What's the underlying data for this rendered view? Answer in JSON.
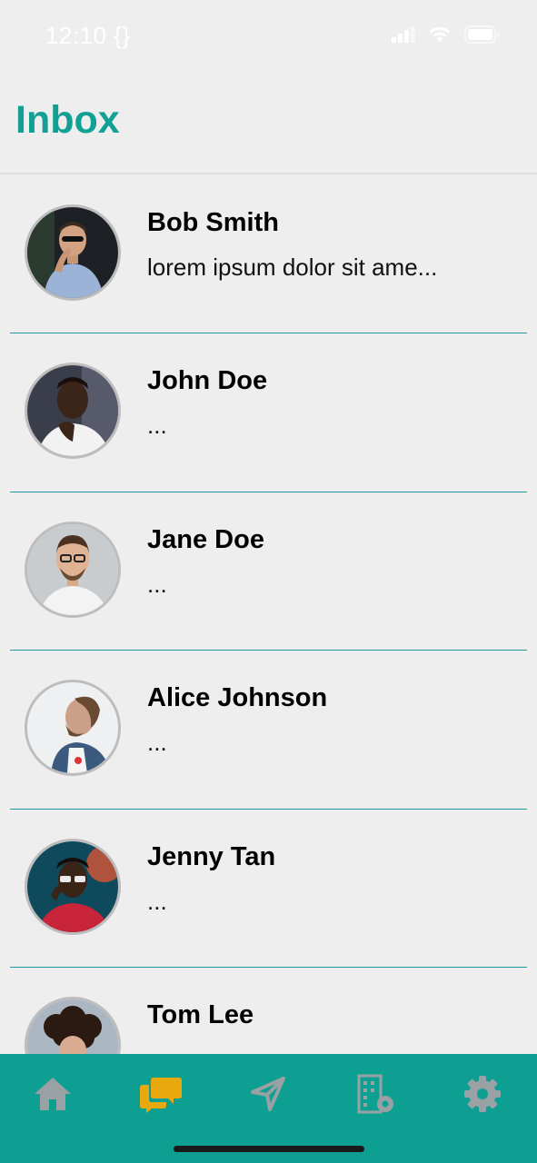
{
  "status_bar": {
    "time": "12:10 {}"
  },
  "header": {
    "title": "Inbox"
  },
  "conversations": [
    {
      "name": "Bob Smith",
      "preview": "lorem ipsum dolor sit ame..."
    },
    {
      "name": "John Doe",
      "preview": "..."
    },
    {
      "name": "Jane Doe",
      "preview": "..."
    },
    {
      "name": "Alice Johnson",
      "preview": "..."
    },
    {
      "name": "Jenny Tan",
      "preview": "..."
    },
    {
      "name": "Tom Lee",
      "preview": ""
    }
  ],
  "tab_bar": {
    "items": [
      {
        "icon": "home-icon",
        "active": false
      },
      {
        "icon": "chat-bubbles-icon",
        "active": true
      },
      {
        "icon": "navigation-arrow-icon",
        "active": false
      },
      {
        "icon": "building-settings-icon",
        "active": false
      },
      {
        "icon": "gear-icon",
        "active": false
      }
    ]
  },
  "colors": {
    "accent": "#12a094",
    "tab_bar": "#0e9f93",
    "tab_active": "#e9a90e",
    "tab_inactive": "#9aa1a4",
    "divider": "#1f9aa0",
    "background": "#eeeeee"
  }
}
